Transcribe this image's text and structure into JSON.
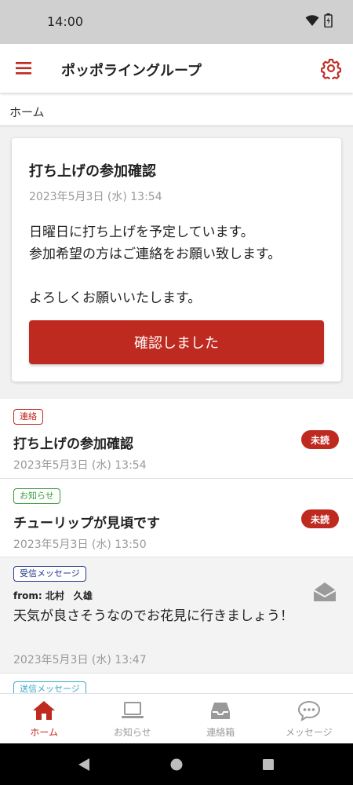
{
  "status_bar": {
    "time": "14:00"
  },
  "header": {
    "title": "ポッポライングループ"
  },
  "breadcrumb": {
    "home": "ホーム"
  },
  "card": {
    "title": "打ち上げの参加確認",
    "date": "2023年5月3日 (水) 13:54",
    "body_line1": "日曜日に打ち上げを予定しています。",
    "body_line2": "参加希望の方はご連絡をお願い致します。",
    "body_line3": "",
    "body_line4": "よろしくお願いいたします。",
    "confirm_button": "確認しました"
  },
  "list": {
    "items": [
      {
        "tag": "連絡",
        "title": "打ち上げの参加確認",
        "badge": "未読",
        "date": "2023年5月3日 (水) 13:54"
      },
      {
        "tag": "お知らせ",
        "title": "チューリップが見頃です",
        "badge": "未読",
        "date": "2023年5月3日 (水) 13:50"
      },
      {
        "tag": "受信メッセージ",
        "from": "from: 北村　久雄",
        "body": "天気が良さそうなのでお花見に行きましょう！",
        "date": "2023年5月3日 (水) 13:47"
      },
      {
        "tag": "送信メッセージ"
      }
    ]
  },
  "bottom_nav": {
    "home": "ホーム",
    "notices": "お知らせ",
    "contacts": "連絡箱",
    "messages": "メッセージ"
  },
  "colors": {
    "accent": "#bf2a20",
    "muted": "#999999",
    "green": "#3a9a3a",
    "navy": "#263a8a",
    "cyan": "#3aa9c9"
  }
}
